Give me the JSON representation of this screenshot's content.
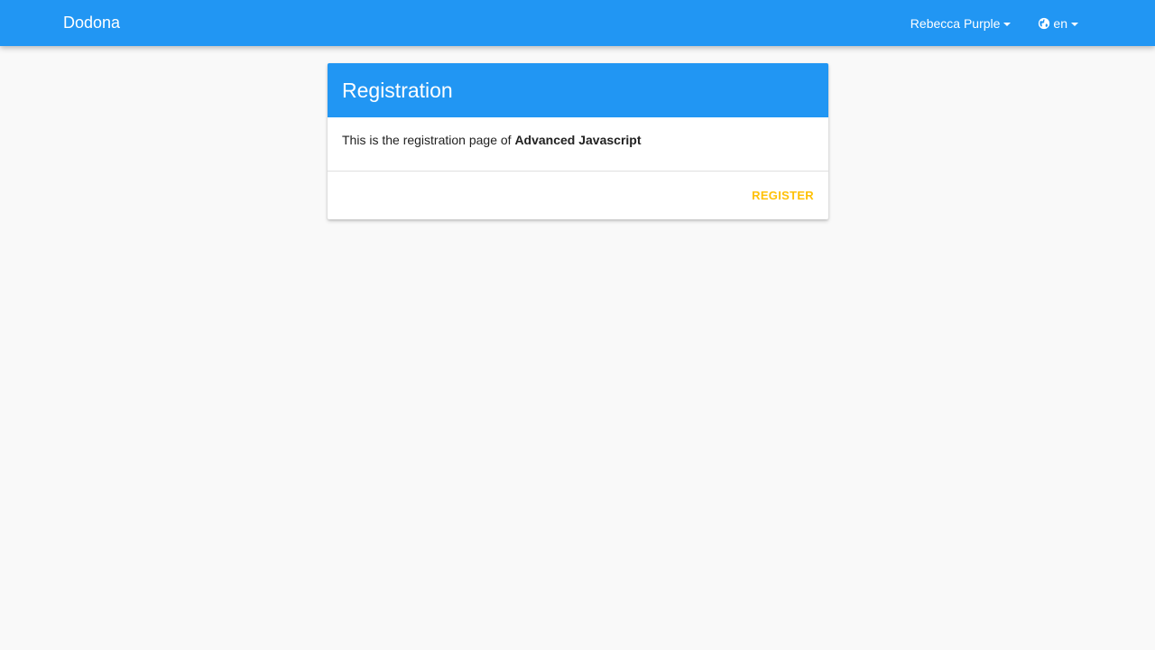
{
  "navbar": {
    "brand": "Dodona",
    "user_name": "Rebecca Purple",
    "language": "en",
    "language_icon": "globe-icon",
    "background_color": "#2196f3"
  },
  "card": {
    "title": "Registration",
    "body_prefix": "This is the registration page of ",
    "course_name": "Advanced Javascript",
    "register_label": "REGISTER",
    "accent_color": "#ffc107"
  }
}
